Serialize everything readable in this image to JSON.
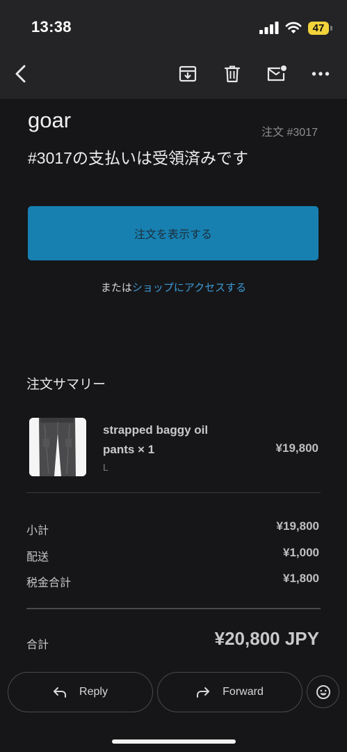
{
  "status_bar": {
    "time": "13:38",
    "battery": "47"
  },
  "toolbar": {
    "back_icon": "chevron-left-icon",
    "archive_icon": "archive-icon",
    "delete_icon": "trash-icon",
    "unread_icon": "mark-unread-icon",
    "more_icon": "more-icon"
  },
  "email": {
    "shop_name": "goar",
    "order_number": "注文 #3017",
    "headline": "#3017の支払いは受領済みです",
    "view_order_label": "注文を表示する",
    "or_prefix": "または",
    "shop_link": "ショップにアクセスする"
  },
  "summary": {
    "title": "注文サマリー",
    "item": {
      "name": "strapped baggy oil pants × 1",
      "variant": "L",
      "price": "¥19,800"
    },
    "subtotal_label": "小計",
    "subtotal_value": "¥19,800",
    "shipping_label": "配送",
    "shipping_value": "¥1,000",
    "tax_label": "税金合計",
    "tax_value": "¥1,800",
    "total_label": "合計",
    "total_value": "¥20,800 JPY"
  },
  "actions": {
    "reply_label": "Reply",
    "forward_label": "Forward",
    "emoji_icon": "smiley-icon"
  },
  "colors": {
    "background": "#161618",
    "toolbar": "#242426",
    "primary_button": "#1780b1",
    "link": "#3c9ad6",
    "battery": "#f1d33b"
  }
}
